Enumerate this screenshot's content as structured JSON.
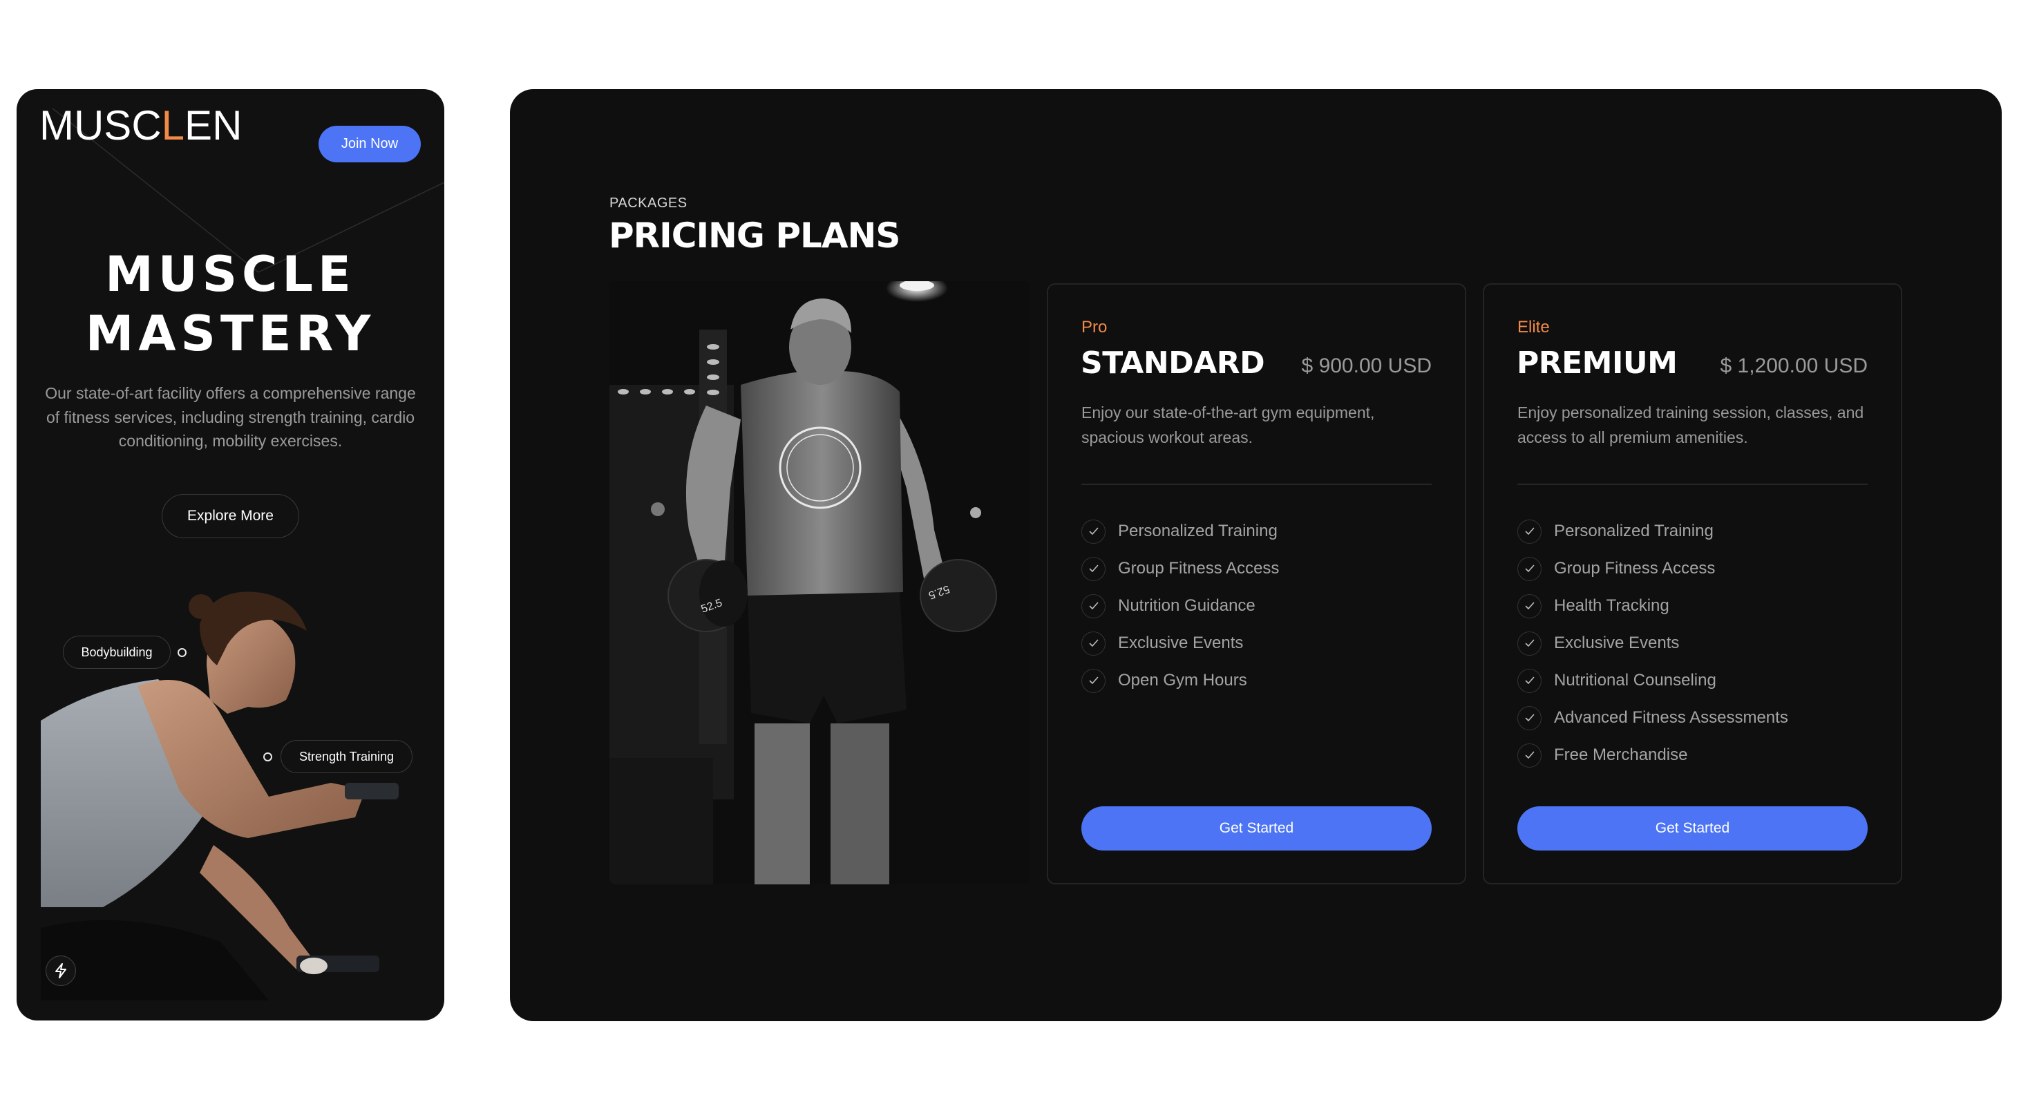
{
  "theme": {
    "accent": "#F28A48",
    "primary": "#4C74F5",
    "background": "#111111"
  },
  "mobile": {
    "logo": {
      "prefix": "MUSC",
      "highlight": "L",
      "suffix": "EN"
    },
    "join_button": "Join Now",
    "hero_title_line1": "MUSCLE",
    "hero_title_line2": "MASTERY",
    "hero_description": "Our state-of-art facility offers a comprehensive range of fitness services, including strength training, cardio conditioning, mobility exercises.",
    "explore_button": "Explore More",
    "tags": [
      "Bodybuilding",
      "Strength Training"
    ],
    "quick_action_icon": "lightning-bolt-icon"
  },
  "pricing": {
    "eyebrow": "PACKAGES",
    "title": "PRICING PLANS",
    "plans": [
      {
        "tier": "Pro",
        "name": "STANDARD",
        "price": "$ 900.00 USD",
        "description": "Enjoy our state-of-the-art gym equipment, spacious workout areas.",
        "features": [
          "Personalized Training",
          "Group Fitness Access",
          "Nutrition Guidance",
          "Exclusive Events",
          "Open Gym Hours"
        ],
        "cta": "Get Started"
      },
      {
        "tier": "Elite",
        "name": "PREMIUM",
        "price": "$ 1,200.00 USD",
        "description": "Enjoy personalized training session, classes, and access to all premium amenities.",
        "features": [
          "Personalized Training",
          "Group Fitness Access",
          "Health Tracking",
          "Exclusive Events",
          "Nutritional Counseling",
          "Advanced Fitness Assessments",
          "Free Merchandise"
        ],
        "cta": "Get Started"
      }
    ],
    "feature_icon": "check-circle-icon"
  }
}
